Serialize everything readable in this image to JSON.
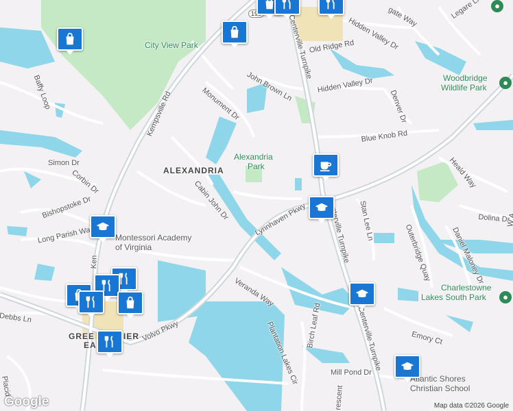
{
  "map": {
    "logo": "Google",
    "attribution": "Map data ©2026 Google",
    "highway_shield": "190",
    "place_labels": {
      "alexandria": "ALEXANDRIA",
      "greenbrier_east_part1": "GREE",
      "greenbrier_east_part2": "IER",
      "greenbrier_east_line2": "EA"
    },
    "parks": {
      "city_view": "City View Park",
      "alexandria_line1": "Alexandria",
      "alexandria_line2": "Park",
      "woodbridge_line1": "Woodbridge",
      "woodbridge_line2": "Wildlife Park",
      "charlestowne_line1": "Charlestowne",
      "charlestowne_line2": "Lakes South Park"
    },
    "schools": {
      "montessori_line1": "Montessori Academy",
      "montessori_line2": "of Virginia",
      "atlantic_line1": "Atlantic Shores",
      "atlantic_line2": "Christian School"
    },
    "streets": {
      "kempsville_rd": "Kempsville Rd",
      "kempsville_rd_lower": "Ken",
      "centerville_tpke_upper": "Centerville Turnpike",
      "centerville_tpke_mid": "Centerville Turnpike",
      "centerville_tpke_lower": "Centerville Turnpike",
      "lynnhaven_pkwy": "Lynnhaven Pkwy",
      "volvo_pkwy": "Volvo Pkwy",
      "veranda_way": "Veranda Way",
      "plantation_lakes": "Plantation Lakes Cir",
      "birch_leaf": "Birch Leaf Rd",
      "mill_pond": "Mill Pond Dr",
      "crescent": "rescent",
      "emory_ct": "Emory Ct",
      "cabin_john": "Cabin John Dr",
      "monument": "Monument Dr",
      "john_brown": "John Brown Ln",
      "old_ridge": "Old Ridge Rd",
      "hidden_valley_dr_upper": "Hidden Valley Dr",
      "hidden_valley_dr_lower": "Hidden Valley Dr",
      "blue_knob": "Blue Knob Rd",
      "denver": "Denver Dr",
      "legare": "Legare Ln",
      "gate_way": "gate Way",
      "heald_way": "Heald Way",
      "dolina": "Dolina Dr",
      "stan_lee": "Stan Lee Ln",
      "outerbridge": "Outerbridge Quay",
      "daniel_maloney": "Daniel Maloney Dr",
      "w_edge": "W A",
      "baffy_loop": "Baffy Loop",
      "simon": "Simon Dr",
      "corbin": "Corbin Dr",
      "bishopstoke": "Bishopstoke Dr",
      "long_parish": "Long Parish Way",
      "debbs": "Debbs Ln",
      "placid": "Placid"
    },
    "markers": [
      {
        "kind": "shopping",
        "icon": "shopping-bag-icon"
      },
      {
        "kind": "shopping",
        "icon": "shopping-bag-icon"
      },
      {
        "kind": "shopping",
        "icon": "shopping-bag-icon"
      },
      {
        "kind": "restaurant",
        "icon": "fork-knife-icon"
      },
      {
        "kind": "restaurant",
        "icon": "fork-knife-icon"
      },
      {
        "kind": "cafe",
        "icon": "coffee-cup-icon"
      },
      {
        "kind": "school",
        "icon": "graduation-cap-icon"
      },
      {
        "kind": "school",
        "icon": "graduation-cap-icon"
      },
      {
        "kind": "school",
        "icon": "graduation-cap-icon"
      },
      {
        "kind": "school",
        "icon": "graduation-cap-icon"
      },
      {
        "kind": "restaurant",
        "icon": "fork-knife-icon"
      },
      {
        "kind": "restaurant",
        "icon": "fork-knife-icon"
      },
      {
        "kind": "shopping",
        "icon": "shopping-bag-icon"
      },
      {
        "kind": "restaurant",
        "icon": "fork-knife-icon"
      },
      {
        "kind": "shopping",
        "icon": "shopping-bag-icon"
      },
      {
        "kind": "restaurant",
        "icon": "fork-knife-icon"
      }
    ],
    "colors": {
      "land": "#f3f1f4",
      "water": "#8fd6ea",
      "park": "#c5e8c5",
      "road": "#ffffff",
      "major_road": "#cfd6dc",
      "marker": "#1976d2",
      "park_label": "#2e8b57"
    }
  }
}
